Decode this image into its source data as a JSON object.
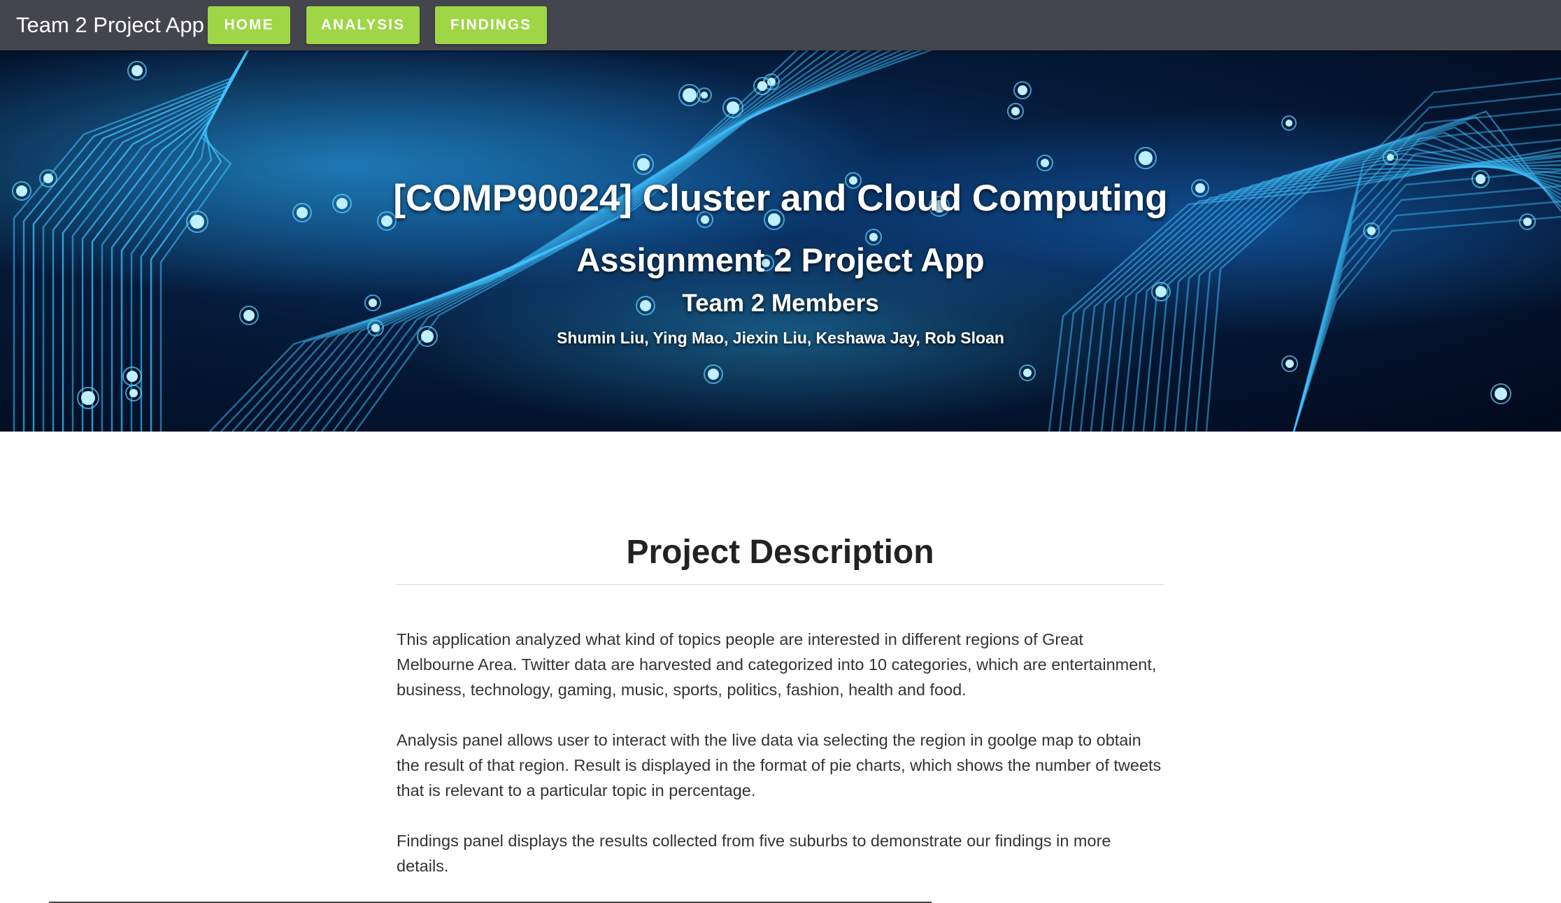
{
  "navbar": {
    "brand": "Team 2 Project App",
    "items": [
      {
        "label": "HOME"
      },
      {
        "label": "ANALYSIS"
      },
      {
        "label": "FINDINGS"
      }
    ],
    "background": "#45454e",
    "button_color": "#9ed646"
  },
  "hero": {
    "title": "[COMP90024] Cluster and Cloud Computing",
    "subtitle": "Assignment 2 Project App",
    "team_heading": "Team 2 Members",
    "members": "Shumin Liu, Ying Mao, Jiexin Liu, Keshawa Jay, Rob Sloan",
    "background_image": "blue circuit board"
  },
  "description": {
    "title": "Project Description",
    "paragraphs": [
      "This application analyzed what kind of topics people are interested in different regions of Great Melbourne Area. Twitter data are harvested and categorized into 10 categories, which are entertainment, business, technology, gaming, music, sports, politics, fashion, health and food.",
      "Analysis panel allows user to interact with the live data via selecting the region in goolge map to obtain the result of that region. Result is displayed in the format of pie charts, which shows the number of tweets that is relevant to a particular topic in percentage.",
      "Findings panel displays the results collected from five suburbs to demonstrate our findings in more details."
    ]
  }
}
